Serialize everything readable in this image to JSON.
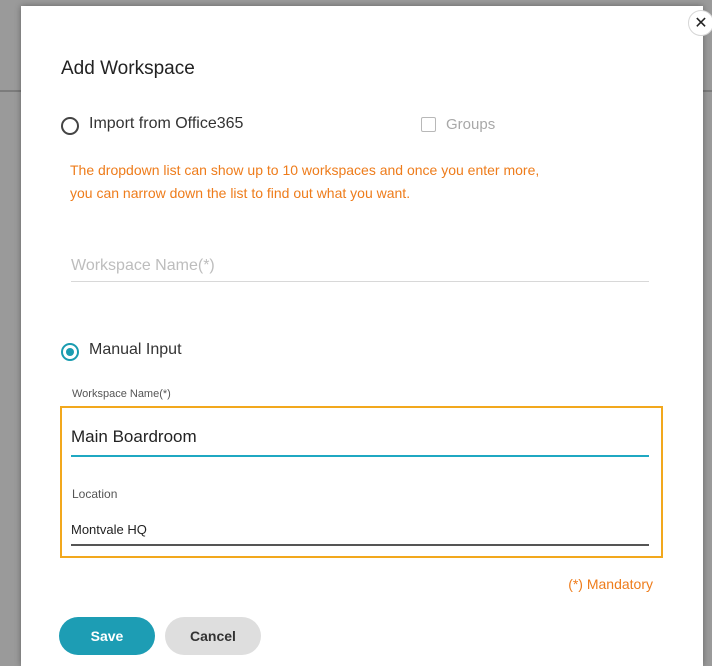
{
  "dialog": {
    "title": "Add Workspace",
    "close_label": "✕"
  },
  "import_option": {
    "label": "Import from Office365",
    "selected": false,
    "groups_label": "Groups",
    "hint_lines": [
      "The dropdown list can show up to 10 workspaces and once you enter more,",
      "you can narrow down the list to find out what you want."
    ],
    "workspace_name_placeholder": "Workspace Name(*)"
  },
  "manual_option": {
    "label": "Manual Input",
    "selected": true,
    "workspace_name_label": "Workspace Name(*)",
    "workspace_name_value": "Main Boardroom",
    "location_label": "Location",
    "location_value": "Montvale HQ"
  },
  "mandatory_note": "(*) Mandatory",
  "buttons": {
    "save": "Save",
    "cancel": "Cancel"
  },
  "colors": {
    "accent_teal": "#1d9db4",
    "hint_orange": "#ee7c1b",
    "focus_border": "#f2a81d"
  }
}
